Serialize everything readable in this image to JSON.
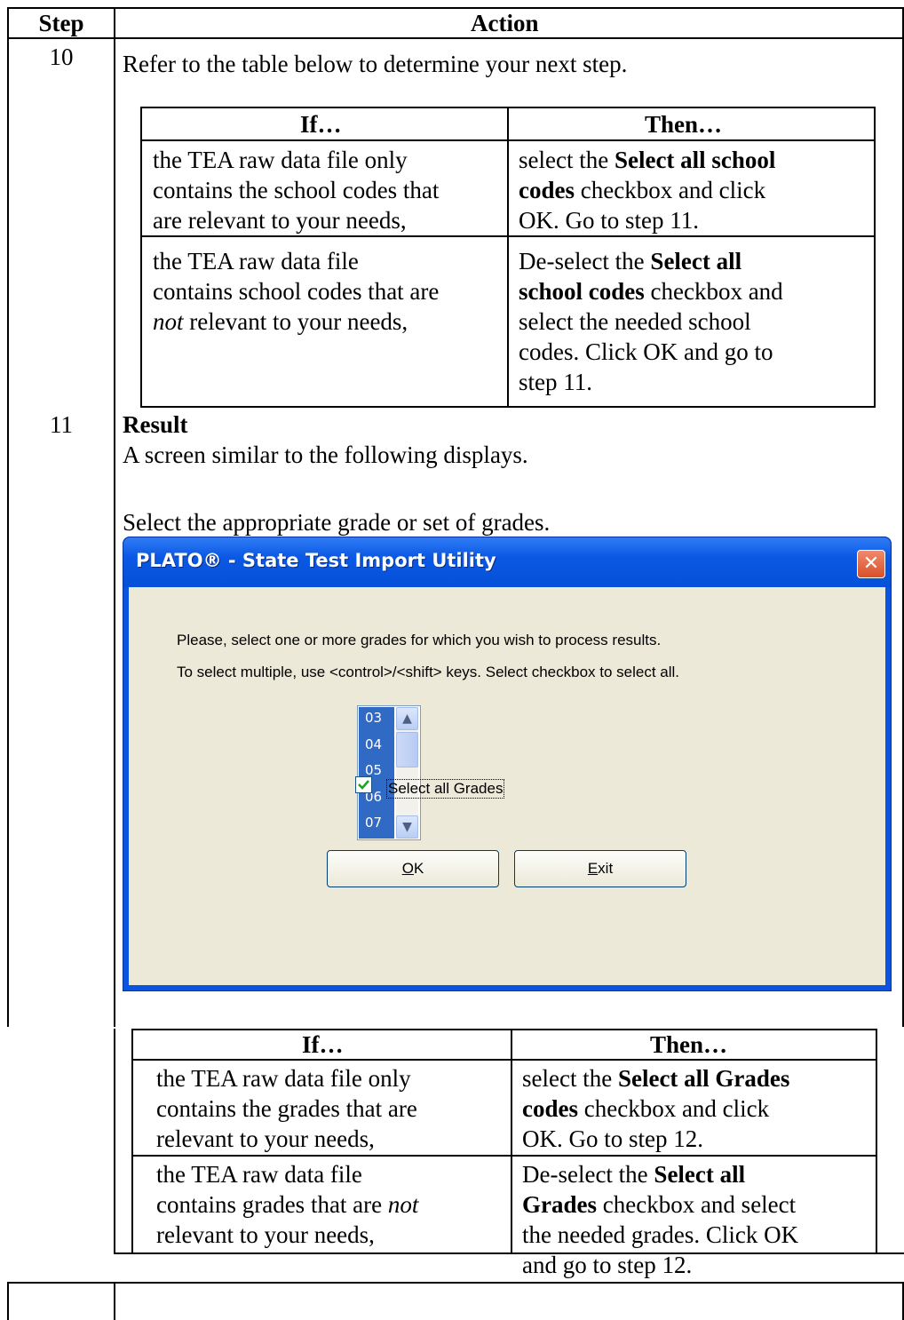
{
  "header": {
    "step": "Step",
    "action": "Action"
  },
  "row10": {
    "step": "10",
    "intro": "Refer to the table below to determine your next step.",
    "table": {
      "if_header": "If…",
      "then_header": "Then…",
      "r1_if": [
        "the TEA raw data file only",
        "contains the school codes that",
        "are relevant to your needs,"
      ],
      "r1_then": [
        "select the ",
        "Select all school",
        "codes",
        " checkbox and click",
        "OK. Go to step 11."
      ],
      "r2_if": [
        "the TEA raw data file",
        "contains school codes that are",
        "not",
        " relevant to your needs,"
      ],
      "r2_then": [
        "De-select the ",
        "Select all",
        "school codes",
        " checkbox and",
        "select the needed school",
        "codes. Click OK and go to",
        "step 11."
      ]
    }
  },
  "row11": {
    "step": "11",
    "result_label": "Result",
    "result_text": "A screen similar to the following displays.",
    "instruction": "Select the appropriate grade or set of grades."
  },
  "dialog": {
    "title": "PLATO® - State Test Import Utility",
    "close_glyph": "✕",
    "line1": "Please, select one or more grades for which you wish to process results.",
    "line2": "To select multiple, use <control>/<shift> keys. Select checkbox to select all.",
    "grades": [
      "03",
      "04",
      "05",
      "06",
      "07"
    ],
    "checkbox_label": "Select all Grades",
    "checkbox_checked": true,
    "ok_label": "OK",
    "exit_label": "Exit"
  },
  "table2": {
    "if_header": "If…",
    "then_header": "Then…",
    "r1_if": [
      "the TEA raw data file only",
      "contains the grades that are",
      "relevant to your needs,"
    ],
    "r1_then": [
      "select the ",
      "Select all Grades",
      "codes",
      " checkbox and click",
      "OK. Go to step 12."
    ],
    "r2_if": [
      "the TEA raw data file",
      "contains grades that are ",
      "not",
      "relevant to your needs,"
    ],
    "r2_then": [
      "De-select the ",
      "Select all",
      "Grades",
      " checkbox and select",
      "the needed grades. Click OK",
      "and go to step 12."
    ]
  }
}
